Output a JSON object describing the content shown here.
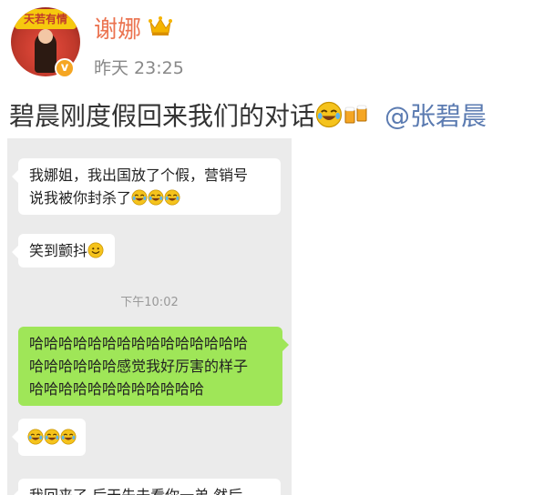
{
  "post": {
    "avatar_banner": "天若有情",
    "username": "谢娜",
    "time": "昨天 23:25",
    "text": "碧晨刚度假回来我们的对话",
    "mention": "@张碧晨",
    "icons": [
      "crown-icon",
      "laughing-emoji-icon",
      "beer-emoji-icon",
      "verified-badge-icon"
    ]
  },
  "chat": {
    "messages": [
      {
        "side": "left",
        "line1": "我娜姐，我出国放了个假，营销号",
        "line2": "说我被你封杀了",
        "emojis": [
          "cry-laugh-emoji",
          "cry-laugh-emoji",
          "cry-laugh-emoji"
        ]
      },
      {
        "side": "left",
        "line1": "笑到颤抖",
        "emojis": [
          "smile-emoji"
        ]
      },
      {
        "side": "right",
        "line1": "哈哈哈哈哈哈哈哈哈哈哈哈哈哈哈",
        "line2": "哈哈哈哈哈哈感觉我好厉害的样子",
        "line3": "哈哈哈哈哈哈哈哈哈哈哈哈"
      },
      {
        "side": "left",
        "emojis": [
          "cry-laugh-emoji",
          "cry-laugh-emoji",
          "cry-laugh-emoji"
        ]
      },
      {
        "side": "left",
        "line1": "我回来了 后天先去看你一弟 然后"
      }
    ],
    "timestamp": "下午10:02"
  },
  "colors": {
    "username": "#eb7350",
    "mention": "#5b7bb1",
    "chat_background": "#ebebeb",
    "self_bubble": "#9fe658",
    "other_bubble": "#ffffff"
  }
}
